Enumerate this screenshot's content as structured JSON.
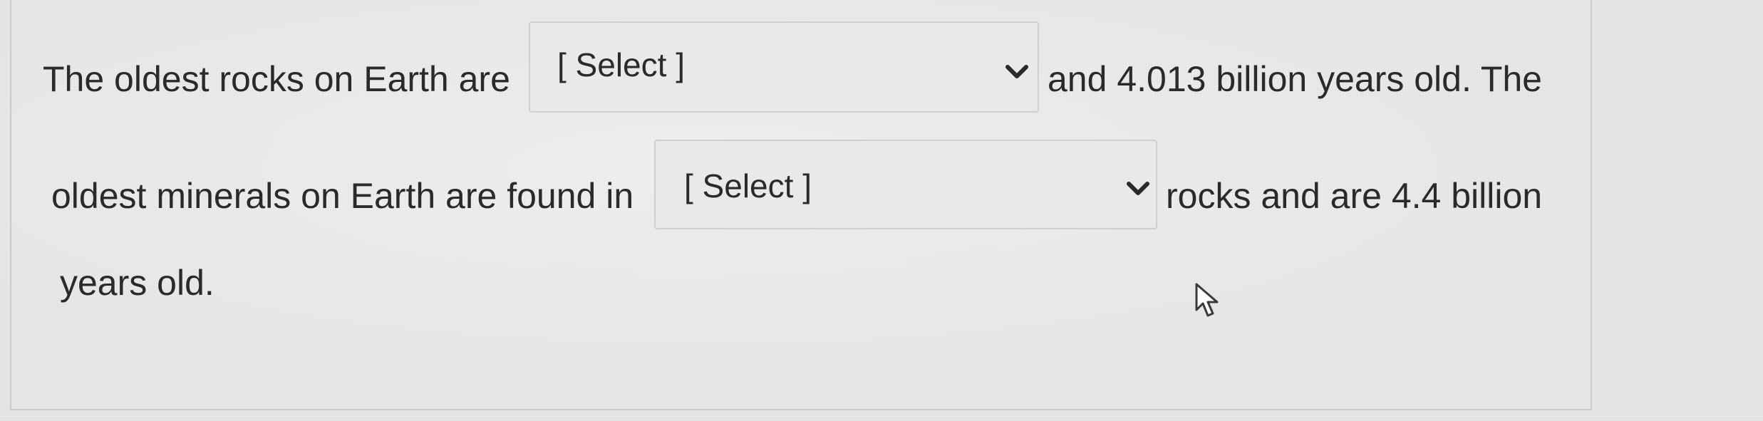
{
  "question": {
    "line1_before": "The oldest rocks on Earth are",
    "line1_after": "and 4.013 billion years old. The",
    "line2_before": "oldest minerals on Earth are found in",
    "line2_after": "rocks and are 4.4 billion",
    "line3": "years old."
  },
  "dropdowns": [
    {
      "selected": "[ Select ]"
    },
    {
      "selected": "[ Select ]"
    }
  ],
  "icons": {
    "dropdown_arrow": "chevron-down-icon",
    "pointer": "mouse-cursor-icon"
  },
  "colors": {
    "text": "#2a2a2a",
    "dropdown_background": "#e9e9e9",
    "border": "#cfcfcf"
  }
}
